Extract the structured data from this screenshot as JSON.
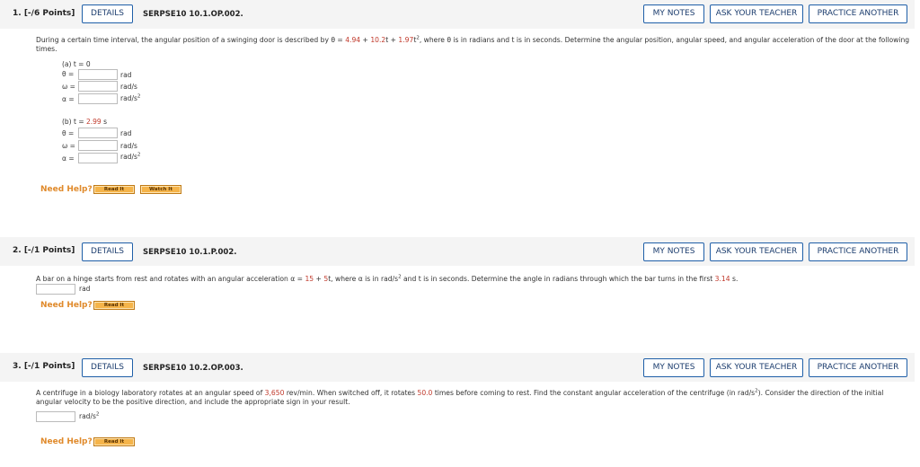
{
  "questions": [
    {
      "number": "1.  [-/6 Points]",
      "details": "DETAILS",
      "code": "SERPSE10 10.1.OP.002.",
      "my_notes": "MY NOTES",
      "ask_teacher": "ASK YOUR TEACHER",
      "practice": "PRACTICE ANOTHER",
      "text_a": "During a certain time interval, the angular position of a swinging door is described by θ = ",
      "eq_1": "4.94",
      "eq_plus1": " + ",
      "eq_2": "10.2",
      "eq_t": "t + ",
      "eq_3": "1.97",
      "eq_t2": "t",
      "eq_exp": "2",
      "text_b": ", where θ is in radians and t is in seconds. Determine the angular position, angular speed, and angular acceleration of the door at the following times.",
      "part_a": {
        "label": "(a) t = 0",
        "rows": [
          {
            "sym": "θ =",
            "unit": "rad",
            "unit_exp": ""
          },
          {
            "sym": "ω =",
            "unit": "rad/s",
            "unit_exp": ""
          },
          {
            "sym": "α =",
            "unit": "rad/s",
            "unit_exp": "2"
          }
        ]
      },
      "part_b": {
        "label_prefix": "(b) t = ",
        "label_value": "2.99",
        "label_suffix": " s",
        "rows": [
          {
            "sym": "θ =",
            "unit": "rad",
            "unit_exp": ""
          },
          {
            "sym": "ω =",
            "unit": "rad/s",
            "unit_exp": ""
          },
          {
            "sym": "α =",
            "unit": "rad/s",
            "unit_exp": "2"
          }
        ]
      },
      "need_help": "Need Help?",
      "read_it": "Read It",
      "watch_it": "Watch It"
    },
    {
      "number": "2.  [-/1 Points]",
      "details": "DETAILS",
      "code": "SERPSE10 10.1.P.002.",
      "my_notes": "MY NOTES",
      "ask_teacher": "ASK YOUR TEACHER",
      "practice": "PRACTICE ANOTHER",
      "text_a": "A bar on a hinge starts from rest and rotates with an angular acceleration α = ",
      "eq_1": "15",
      "eq_plus": " + ",
      "eq_2": "5",
      "text_b": "t, where α is in rad/s",
      "text_b_exp": "2",
      "text_c": " and t is in seconds. Determine the angle in radians through which the bar turns in the first ",
      "eq_3": "3.14",
      "text_d": " s.",
      "unit": "rad",
      "need_help": "Need Help?",
      "read_it": "Read It"
    },
    {
      "number": "3.  [-/1 Points]",
      "details": "DETAILS",
      "code": "SERPSE10 10.2.OP.003.",
      "my_notes": "MY NOTES",
      "ask_teacher": "ASK YOUR TEACHER",
      "practice": "PRACTICE ANOTHER",
      "text_a": "A centrifuge in a biology laboratory rotates at an angular speed of ",
      "eq_1": "3,650",
      "text_b": " rev/min. When switched off, it rotates ",
      "eq_2": "50.0",
      "text_c": " times before coming to rest. Find the constant angular acceleration of the centrifuge (in rad/s",
      "text_c_exp": "2",
      "text_d": "). Consider the direction of the initial angular velocity to be the positive direction, and include the appropriate sign in your result.",
      "unit": "rad/s",
      "unit_exp": "2",
      "need_help": "Need Help?",
      "read_it": "Read It"
    }
  ],
  "colors": {
    "accent_blue": "#1f5fa8",
    "given_value_red": "#c0392b",
    "help_orange": "#e08a2b",
    "help_button": "#f5b44a"
  }
}
